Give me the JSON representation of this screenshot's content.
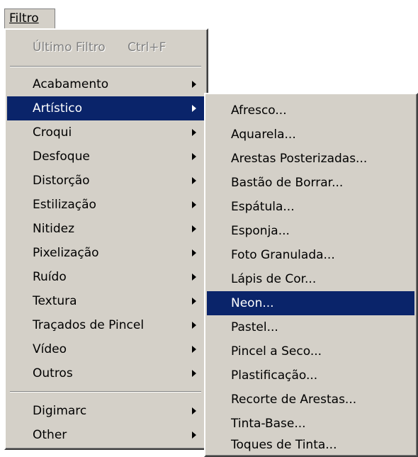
{
  "menubar": {
    "filtro_label": "Filtro"
  },
  "main_menu": {
    "last_filter": {
      "label": "Último Filtro",
      "shortcut": "Ctrl+F"
    },
    "groups": [
      "Acabamento",
      "Artístico",
      "Croqui",
      "Desfoque",
      "Distorção",
      "Estilização",
      "Nitidez",
      "Pixelização",
      "Ruído",
      "Textura",
      "Traçados de Pincel",
      "Vídeo",
      "Outros"
    ],
    "plugins": [
      "Digimarc",
      "Other"
    ],
    "selected": "Artístico"
  },
  "submenu": {
    "items": [
      "Afresco...",
      "Aquarela...",
      "Arestas Posterizadas...",
      "Bastão de Borrar...",
      "Espátula...",
      "Esponja...",
      "Foto Granulada...",
      "Lápis de Cor...",
      "Neon...",
      "Pastel...",
      "Pincel a Seco...",
      "Plastificação...",
      "Recorte de Arestas...",
      "Tinta-Base...",
      "Toques de Tinta..."
    ],
    "selected": "Neon..."
  },
  "colors": {
    "menu_bg": "#d4d0c8",
    "highlight": "#0a246a",
    "highlight_text": "#ffffff",
    "disabled_text": "#808080"
  },
  "icons": {
    "submenu_arrow": "triangle-right-icon"
  }
}
